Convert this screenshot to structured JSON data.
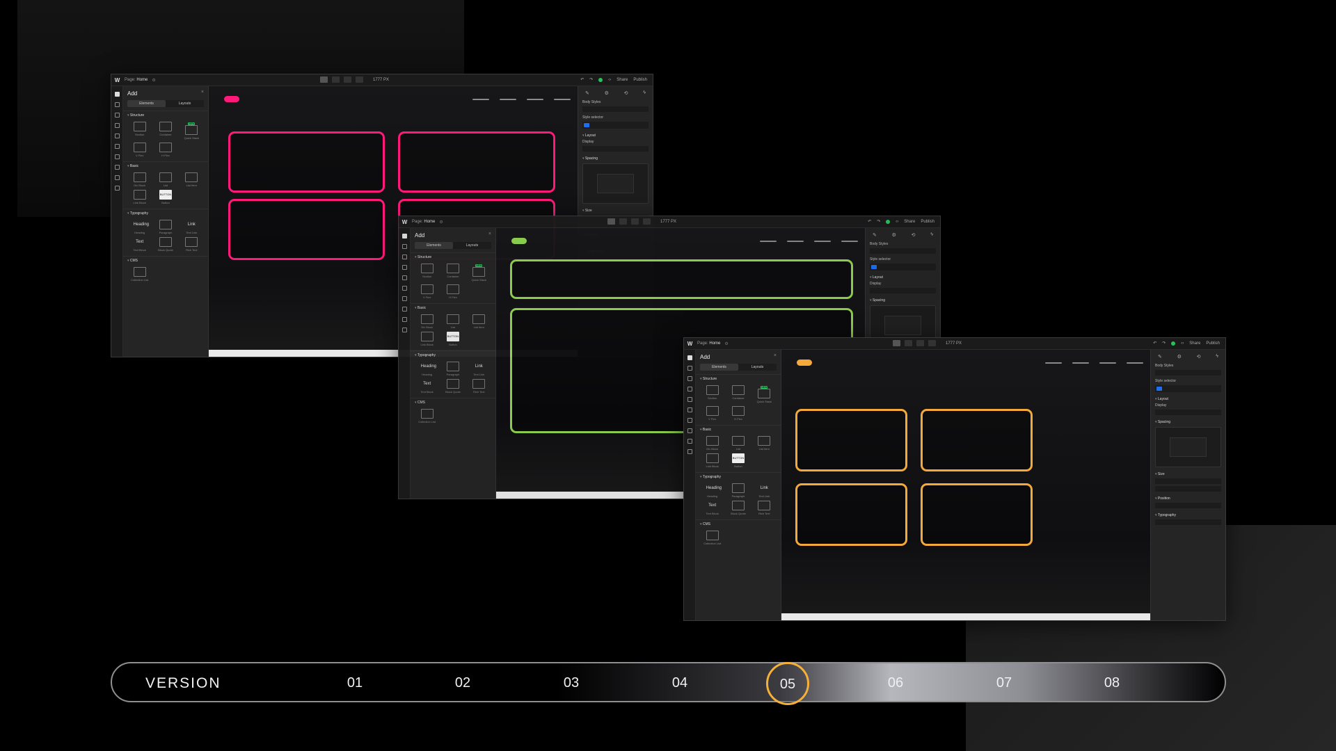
{
  "app": {
    "logo": "W",
    "page_prefix": "Page:",
    "page_name": "Home",
    "width_value": "1777 PX",
    "share": "Share",
    "publish": "Publish"
  },
  "add_panel": {
    "title": "Add",
    "close": "×",
    "tabs": [
      "Elements",
      "Layouts"
    ],
    "sections": {
      "structure": "Structure",
      "basic": "Basic",
      "typography": "Typography",
      "cms": "CMS"
    },
    "structure_items": [
      "Section",
      "Container",
      "Quick Stack",
      "V Flex",
      "H Flex"
    ],
    "new_badge": "NEW",
    "basic_items": [
      "Div Block",
      "List",
      "List Item",
      "Link Block",
      "Button"
    ],
    "button_preview": "BUTTON",
    "typography_items": [
      "Heading",
      "Paragraph",
      "Text Link",
      "Text Block",
      "Block Quote",
      "Rich Text"
    ],
    "typography_previews": [
      "Heading",
      "",
      "Link",
      "Text",
      "",
      ""
    ],
    "cms_items": [
      "Collection List"
    ]
  },
  "style_panel": {
    "body_styles": "Body Styles",
    "style_selector": "Style selector",
    "layout": "Layout",
    "display": "Display",
    "spacing": "Spacing",
    "size": "Size",
    "position": "Position",
    "typography": "Typography"
  },
  "variants": [
    {
      "accent": "#ff1a7a"
    },
    {
      "accent": "#8fd14f"
    },
    {
      "accent": "#f5a93a"
    }
  ],
  "timeline": {
    "label": "VERSION",
    "versions": [
      "01",
      "02",
      "03",
      "04",
      "05",
      "06",
      "07",
      "08"
    ],
    "active_version": "05",
    "active_color": "#f5b03a"
  }
}
